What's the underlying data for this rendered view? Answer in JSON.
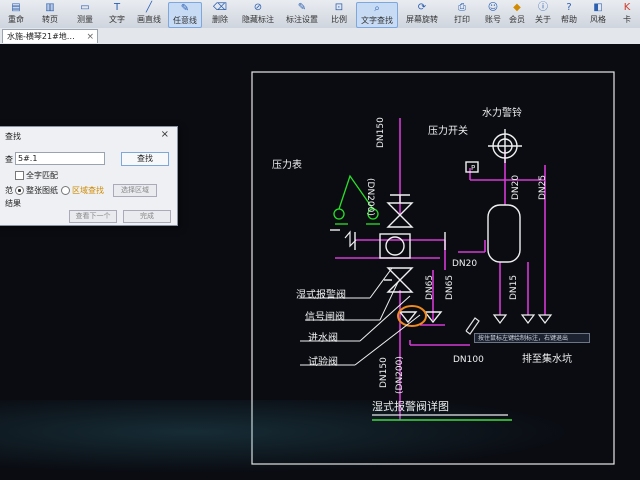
{
  "toolbar": {
    "items": [
      {
        "label": "重命",
        "icon": "rename-icon"
      },
      {
        "label": "转页",
        "icon": "page-icon"
      },
      {
        "label": "测量",
        "icon": "measure-icon"
      },
      {
        "label": "文字",
        "icon": "text-icon"
      },
      {
        "label": "画直线",
        "icon": "line-icon"
      },
      {
        "label": "任意线",
        "icon": "pen-icon"
      },
      {
        "label": "删除",
        "icon": "delete-icon"
      },
      {
        "label": "隐藏标注",
        "icon": "hide-icon"
      },
      {
        "label": "标注设置",
        "icon": "settings-icon"
      },
      {
        "label": "比例",
        "icon": "scale-icon"
      },
      {
        "label": "文字查找",
        "icon": "search-icon"
      },
      {
        "label": "屏幕旋转",
        "icon": "rotate-icon"
      },
      {
        "label": "打印",
        "icon": "print-icon"
      },
      {
        "label": "账号",
        "icon": "user-icon"
      },
      {
        "label": "会员",
        "icon": "vip-icon"
      },
      {
        "label": "关于",
        "icon": "info-icon"
      },
      {
        "label": "帮助",
        "icon": "help-icon"
      },
      {
        "label": "风格",
        "icon": "style-icon"
      },
      {
        "label": "卡",
        "icon": "card-icon"
      }
    ]
  },
  "tab": {
    "title": "水施-横琴21#地…",
    "close": "×"
  },
  "find_dialog": {
    "title": "查找",
    "close": "×",
    "find_label": "查",
    "input_value": "5#.1",
    "find_button": "查找",
    "option_whole_word": "全字匹配",
    "range_label": "范",
    "radio_whole": "整张图纸",
    "radio_region": "区域查找",
    "select_region_button": "选择区域",
    "result_label": "结果",
    "prev_button": "查看下一个",
    "done_button": "完成"
  },
  "drawing": {
    "labels": {
      "pressure_gauge": "压力表",
      "pressure_switch": "压力开关",
      "water_alarm": "水力警铃",
      "dn150_top": "DN150",
      "dn200_top": "(DN200)",
      "dn20_right": "DN20",
      "dn25_right": "DN25",
      "dn20_mid": "DN20",
      "dn15": "DN15",
      "dn65": "DN65",
      "dn65_b": "DN65",
      "dn150_bottom": "DN150",
      "dn200_bottom": "(DN200)",
      "dn100": "DN100",
      "wet_alarm_valve": "湿式报警阀",
      "signal_valve": "信号闸阀",
      "inlet_valve": "进水阀",
      "test_valve": "试验阀",
      "drain": "排至集水坑",
      "title": "湿式报警阀详图",
      "p_box": "P"
    }
  },
  "tooltip": {
    "text": "按住鼠标左键绘制标注，右键退出"
  }
}
